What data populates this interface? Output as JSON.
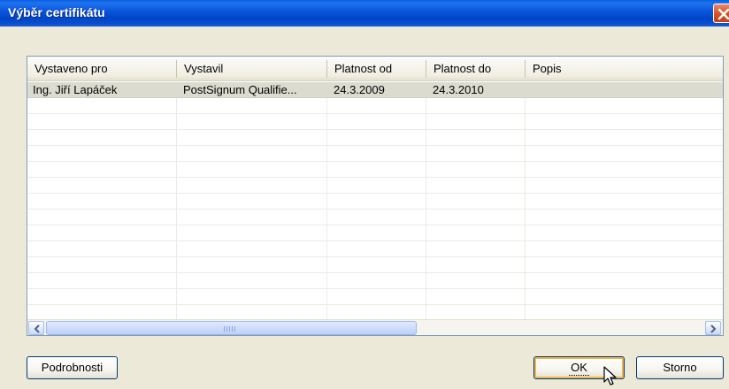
{
  "window": {
    "title": "Výběr certifikátu"
  },
  "columns": [
    {
      "label": "Vystaveno pro"
    },
    {
      "label": "Vystavil"
    },
    {
      "label": "Platnost od"
    },
    {
      "label": "Platnost do"
    },
    {
      "label": "Popis"
    }
  ],
  "certificates": [
    {
      "issued_to": "Ing. Jiří Lapáček",
      "issued_by": "PostSignum Qualifie...",
      "valid_from": "24.3.2009",
      "valid_to": "24.3.2010",
      "description": ""
    }
  ],
  "buttons": {
    "details": "Podrobnosti",
    "ok": "OK",
    "cancel": "Storno"
  },
  "icons": {
    "close": "close-icon",
    "scroll_left": "arrow-left-icon",
    "scroll_right": "arrow-right-icon",
    "cursor": "mouse-pointer-icon"
  },
  "colors": {
    "titlebar": "#0853d9",
    "close": "#d9532a",
    "selection": "#dcdbd0",
    "default_focus": "#f0b448"
  }
}
